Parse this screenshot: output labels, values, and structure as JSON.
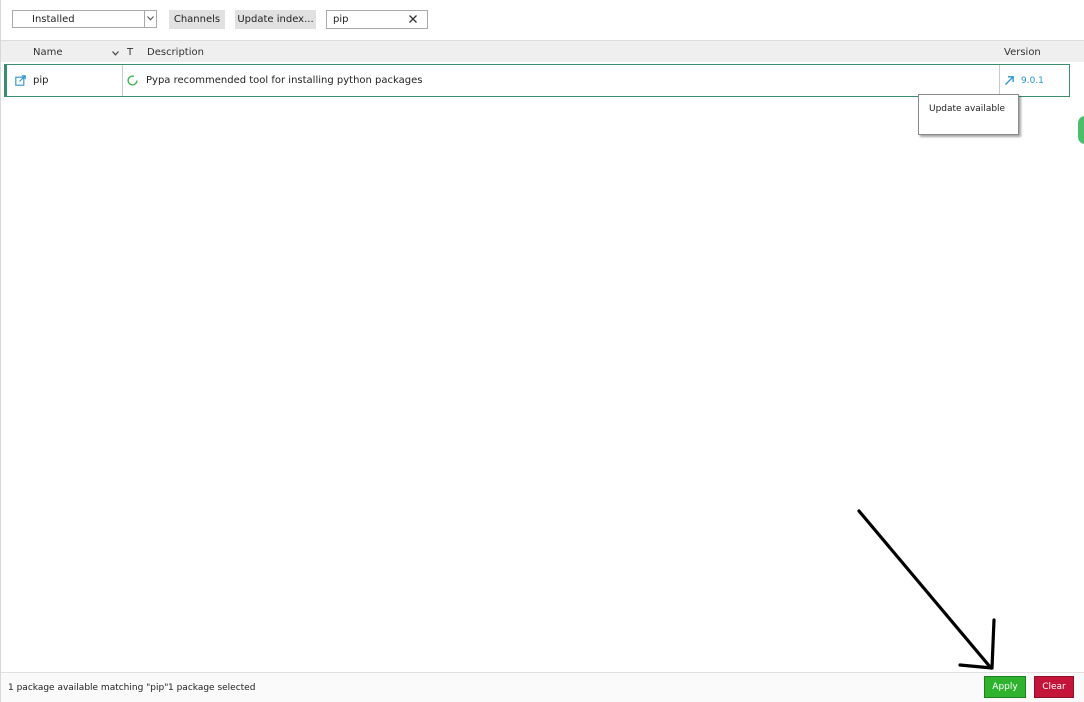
{
  "toolbar": {
    "filter_select": {
      "value": "Installed"
    },
    "channels_label": "Channels",
    "update_index_label": "Update index...",
    "search": {
      "value": "pip",
      "placeholder": ""
    }
  },
  "table": {
    "columns": {
      "name": "Name",
      "type": "T",
      "description": "Description",
      "version": "Version"
    },
    "rows": [
      {
        "name": "pip",
        "description": "Pypa recommended tool for installing python packages",
        "version": "9.0.1"
      }
    ]
  },
  "tooltip": {
    "text": "Update available"
  },
  "status": {
    "matching": "1 package available matching \"pip\"",
    "selected": "1 package selected"
  },
  "actions": {
    "apply_label": "Apply",
    "clear_label": "Clear"
  },
  "colors": {
    "accent_green": "#3a8e6c",
    "apply_green": "#2fb32f",
    "clear_red": "#c4143a",
    "version_blue": "#2b93cf",
    "annotation": "#000000"
  },
  "icons": {
    "row_check": "open-in-box-icon",
    "row_status": "installed-circle-icon",
    "row_update": "upgrade-arrow-icon",
    "search_clear": "close-icon"
  }
}
